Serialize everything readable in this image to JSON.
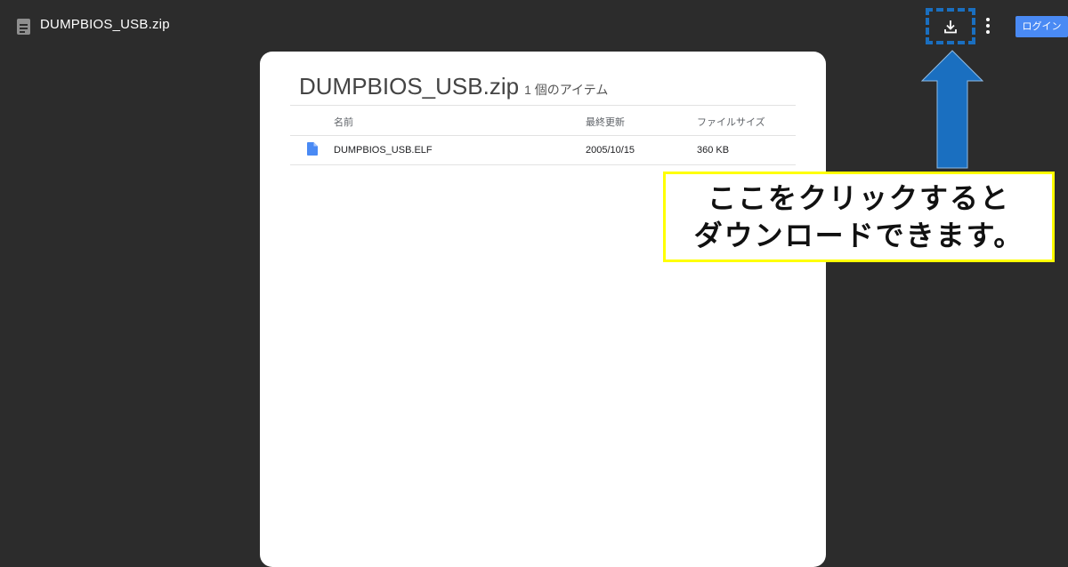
{
  "header": {
    "title": "DUMPBIOS_USB.zip",
    "file_icon": "zip-file-icon",
    "download_icon": "download-icon",
    "more_icon": "more-vert-icon",
    "login_label": "ログイン",
    "login_color": "#4a8af4"
  },
  "card": {
    "title": "DUMPBIOS_USB.zip",
    "item_count": "1 個のアイテム",
    "columns": {
      "name": "名前",
      "modified": "最終更新",
      "size": "ファイルサイズ"
    },
    "rows": [
      {
        "icon": "document-icon",
        "name": "DUMPBIOS_USB.ELF",
        "modified": "2005/10/15",
        "size": "360 KB"
      }
    ]
  },
  "annotation": {
    "line1": "ここをクリックすると",
    "line2": "ダウンロードできます。",
    "arrow_color": "#1a6fc0",
    "border_color": "#ffff00"
  }
}
